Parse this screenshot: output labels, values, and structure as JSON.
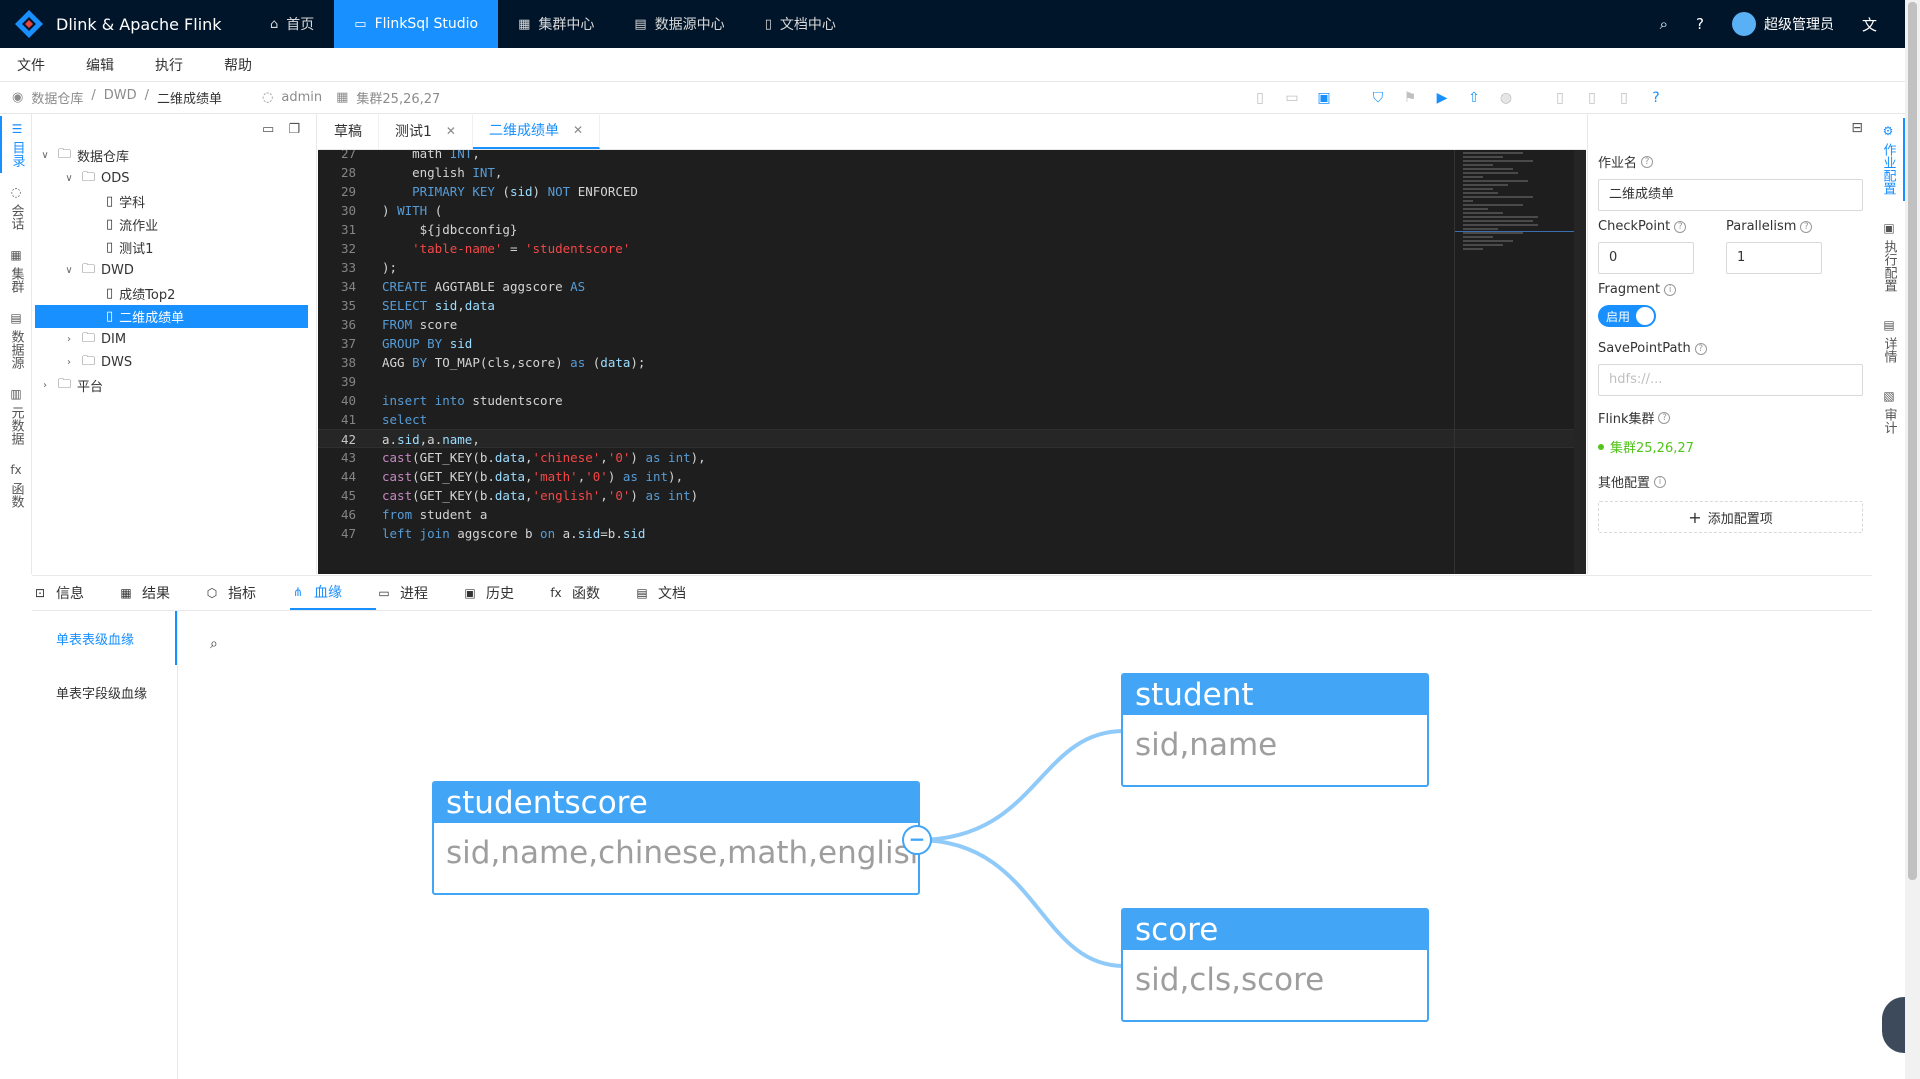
{
  "app": {
    "title": "Dlink & Apache Flink"
  },
  "nav": [
    {
      "label": "首页",
      "icon": "home-icon",
      "glyph": "⌂"
    },
    {
      "label": "FlinkSql Studio",
      "icon": "studio-icon",
      "glyph": "▭"
    },
    {
      "label": "集群中心",
      "icon": "cluster-icon",
      "glyph": "▦"
    },
    {
      "label": "数据源中心",
      "icon": "database-icon",
      "glyph": "▤"
    },
    {
      "label": "文档中心",
      "icon": "document-icon",
      "glyph": "▯"
    }
  ],
  "user": {
    "name": "超级管理员"
  },
  "menu": [
    "文件",
    "编辑",
    "执行",
    "帮助"
  ],
  "breadcrumb": {
    "items": [
      "数据仓库",
      "DWD",
      "二维成绩单"
    ],
    "sep": "/",
    "user": "admin",
    "cluster": "集群25,26,27"
  },
  "tree": {
    "nodes": [
      {
        "label": "数据仓库",
        "level": 0,
        "arrow": "∨",
        "type": "folder"
      },
      {
        "label": "ODS",
        "level": 1,
        "arrow": "∨",
        "type": "folder"
      },
      {
        "label": "学科",
        "level": 2,
        "arrow": "",
        "type": "file"
      },
      {
        "label": "流作业",
        "level": 2,
        "arrow": "",
        "type": "file"
      },
      {
        "label": "测试1",
        "level": 2,
        "arrow": "",
        "type": "file"
      },
      {
        "label": "DWD",
        "level": 1,
        "arrow": "∨",
        "type": "folder"
      },
      {
        "label": "成绩Top2",
        "level": 2,
        "arrow": "",
        "type": "file"
      },
      {
        "label": "二维成绩单",
        "level": 2,
        "arrow": "",
        "type": "file",
        "selected": true
      },
      {
        "label": "DIM",
        "level": 1,
        "arrow": "›",
        "type": "folder"
      },
      {
        "label": "DWS",
        "level": 1,
        "arrow": "›",
        "type": "folder"
      },
      {
        "label": "平台",
        "level": 0,
        "arrow": "›",
        "type": "folder"
      }
    ]
  },
  "left_tabs": [
    {
      "label": "目录",
      "icon": "list-icon",
      "glyph": "☰"
    },
    {
      "label": "会话",
      "icon": "session-icon",
      "glyph": "◌"
    },
    {
      "label": "集群",
      "icon": "cluster-icon",
      "glyph": "▦"
    },
    {
      "label": "数据源",
      "icon": "database-icon",
      "glyph": "▤"
    },
    {
      "label": "元数据",
      "icon": "metadata-icon",
      "glyph": "▥"
    },
    {
      "label": "函数",
      "icon": "function-icon",
      "glyph": "fx"
    }
  ],
  "editor_tabs": [
    {
      "label": "草稿",
      "closable": false
    },
    {
      "label": "测试1",
      "closable": true
    },
    {
      "label": "二维成绩单",
      "closable": true,
      "active": true
    }
  ],
  "code_lines": [
    {
      "n": "27",
      "h": "    math <span class=\"kw\">INT</span>,"
    },
    {
      "n": "28",
      "h": "    english <span class=\"kw\">INT</span>,"
    },
    {
      "n": "29",
      "h": "    <span class=\"kw\">PRIMARY KEY</span> (<span class=\"id\">sid</span>) <span class=\"kw\">NOT</span> ENFORCED"
    },
    {
      "n": "30",
      "h": ") <span class=\"kw\">WITH</span> ("
    },
    {
      "n": "31",
      "h": "     ${jdbcconfig}"
    },
    {
      "n": "32",
      "h": "    <span class=\"str\">'table-name'</span> = <span class=\"str\">'studentscore'</span>"
    },
    {
      "n": "33",
      "h": ");"
    },
    {
      "n": "34",
      "h": "<span class=\"kw\">CREATE</span> AGGTABLE aggscore <span class=\"kw\">AS</span>"
    },
    {
      "n": "35",
      "h": "<span class=\"kw\">SELECT</span> <span class=\"id\">sid</span>,<span class=\"id\">data</span>"
    },
    {
      "n": "36",
      "h": "<span class=\"kw\">FROM</span> score"
    },
    {
      "n": "37",
      "h": "<span class=\"kw\">GROUP BY</span> <span class=\"id\">sid</span>"
    },
    {
      "n": "38",
      "h": "AGG <span class=\"kw\">BY</span> TO_MAP(cls,score) <span class=\"kw\">as</span> (<span class=\"id\">data</span>);"
    },
    {
      "n": "39",
      "h": ""
    },
    {
      "n": "40",
      "h": "<span class=\"kw\">insert into</span> studentscore"
    },
    {
      "n": "41",
      "h": "<span class=\"kw\">select</span>"
    },
    {
      "n": "42",
      "h": "a.<span class=\"id\">sid</span>,a.<span class=\"id\">name</span>,",
      "cur": true
    },
    {
      "n": "43",
      "h": "<span class=\"fn\">cast</span>(GET_KEY(b.<span class=\"id\">data</span>,<span class=\"str\">'chinese'</span>,<span class=\"str\">'0'</span>) <span class=\"kw\">as</span> <span class=\"kw\">int</span>),"
    },
    {
      "n": "44",
      "h": "<span class=\"fn\">cast</span>(GET_KEY(b.<span class=\"id\">data</span>,<span class=\"str\">'math'</span>,<span class=\"str\">'0'</span>) <span class=\"kw\">as</span> <span class=\"kw\">int</span>),"
    },
    {
      "n": "45",
      "h": "<span class=\"fn\">cast</span>(GET_KEY(b.<span class=\"id\">data</span>,<span class=\"str\">'english'</span>,<span class=\"str\">'0'</span>) <span class=\"kw\">as</span> <span class=\"kw\">int</span>)"
    },
    {
      "n": "46",
      "h": "<span class=\"kw\">from</span> student a"
    },
    {
      "n": "47",
      "h": "<span class=\"kw\">left join</span> aggscore b <span class=\"kw\">on</span> a.<span class=\"id\">sid</span>=b.<span class=\"id\">sid</span>"
    }
  ],
  "config": {
    "job_name_label": "作业名",
    "job_name": "二维成绩单",
    "checkpoint_label": "CheckPoint",
    "checkpoint": "0",
    "parallelism_label": "Parallelism",
    "parallelism": "1",
    "fragment_label": "Fragment",
    "fragment_switch": "启用",
    "savepoint_label": "SavePointPath",
    "savepoint_placeholder": "hdfs://...",
    "cluster_label": "Flink集群",
    "cluster": "集群25,26,27",
    "other_label": "其他配置",
    "add_button": "添加配置项"
  },
  "right_tabs": [
    {
      "label": "作业配置",
      "icon": "settings-icon",
      "glyph": "⚙"
    },
    {
      "label": "执行配置",
      "icon": "calendar-icon",
      "glyph": "▣"
    },
    {
      "label": "详情",
      "icon": "detail-icon",
      "glyph": "▤"
    },
    {
      "label": "审计",
      "icon": "audit-icon",
      "glyph": "▧"
    }
  ],
  "bottom_tabs": [
    {
      "label": "信息",
      "icon": "info-icon",
      "glyph": "⊡"
    },
    {
      "label": "结果",
      "icon": "table-icon",
      "glyph": "▦"
    },
    {
      "label": "指标",
      "icon": "metrics-icon",
      "glyph": "⬡"
    },
    {
      "label": "血缘",
      "icon": "lineage-icon",
      "glyph": "⋔",
      "active": true
    },
    {
      "label": "进程",
      "icon": "monitor-icon",
      "glyph": "▭"
    },
    {
      "label": "历史",
      "icon": "history-icon",
      "glyph": "▣"
    },
    {
      "label": "函数",
      "icon": "function-icon",
      "glyph": "fx"
    },
    {
      "label": "文档",
      "icon": "doc-icon",
      "glyph": "▤"
    }
  ],
  "lineage": {
    "menu": [
      "单表表级血缘",
      "单表字段级血缘"
    ],
    "nodes": [
      {
        "id": "studentscore",
        "name": "studentscore",
        "fields": "sid,name,chinese,math,english"
      },
      {
        "id": "student",
        "name": "student",
        "fields": "sid,name"
      },
      {
        "id": "score",
        "name": "score",
        "fields": "sid,cls,score"
      }
    ],
    "collapse_glyph": "−"
  }
}
